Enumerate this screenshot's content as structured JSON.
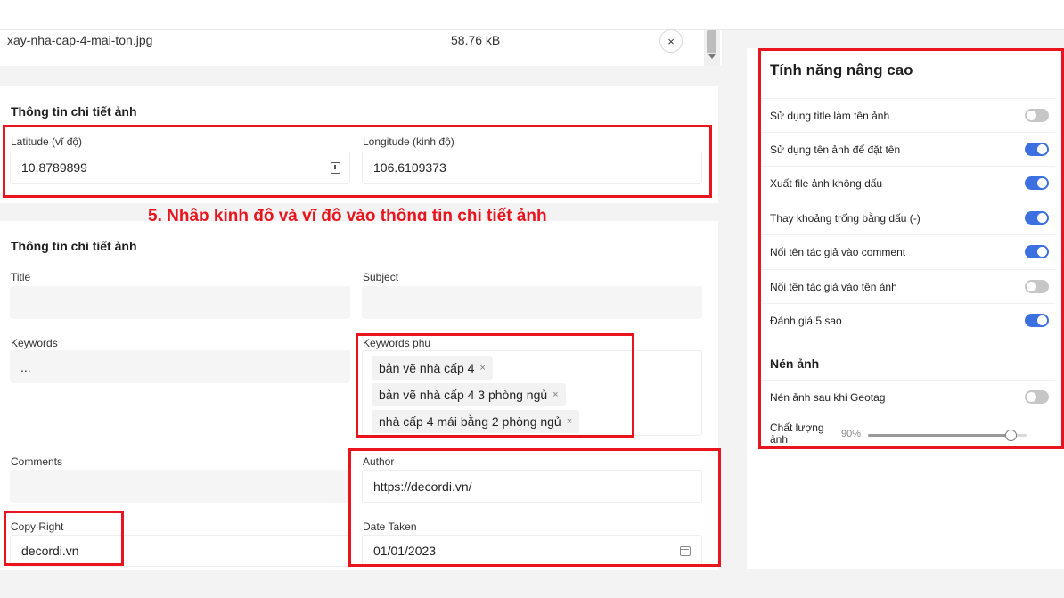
{
  "file": {
    "name": "xay-nha-cap-4-mai-ton.jpg",
    "size": "58.76 kB",
    "close_glyph": "×"
  },
  "section1": {
    "title": "Thông tin chi tiết ảnh",
    "latitude_label": "Latitude (vĩ độ)",
    "latitude_value": "10.8789899",
    "longitude_label": "Longitude (kinh độ)",
    "longitude_value": "106.6109373"
  },
  "caption": "5. Nhập kinh độ và vĩ độ vào thông tin chi tiết ảnh",
  "section2": {
    "title": "Thông tin chi tiết ảnh",
    "title_label": "Title",
    "subject_label": "Subject",
    "keywords_label": "Keywords",
    "keywords_value": "...",
    "keywords_sub_label": "Keywords phụ",
    "keywords_sub_tags": [
      "bản vẽ nhà cấp 4",
      "bản vẽ nhà cấp 4 3 phòng ngủ",
      "nhà cấp 4 mái bằng 2 phòng ngủ"
    ],
    "tag_remove_glyph": "×",
    "comments_label": "Comments",
    "author_label": "Author",
    "author_value": "https://decordi.vn/",
    "copyright_label": "Copy Right",
    "copyright_value": "decordi.vn",
    "date_label": "Date Taken",
    "date_value": "01/01/2023"
  },
  "advanced": {
    "title": "Tính năng nâng cao",
    "toggles": [
      {
        "label": "Sử dụng title làm tên ảnh",
        "on": false
      },
      {
        "label": "Sử dụng tên ảnh để đặt tên",
        "on": true
      },
      {
        "label": "Xuất file ảnh không dấu",
        "on": true
      },
      {
        "label": "Thay khoảng trống bằng dấu (-)",
        "on": true
      },
      {
        "label": "Nối tên tác giả vào comment",
        "on": true
      },
      {
        "label": "Nối tên tác giả vào tên ảnh",
        "on": false
      },
      {
        "label": "Đánh giá 5 sao",
        "on": true
      }
    ],
    "compress_title": "Nén ảnh",
    "compress_toggle": {
      "label": "Nén ảnh sau khi Geotag",
      "on": false
    },
    "quality_label": "Chất lượng ảnh",
    "quality_value": "90%",
    "quality_fraction": 0.9
  },
  "colors": {
    "accent": "#3c6fe0",
    "highlight": "#e8141e"
  }
}
